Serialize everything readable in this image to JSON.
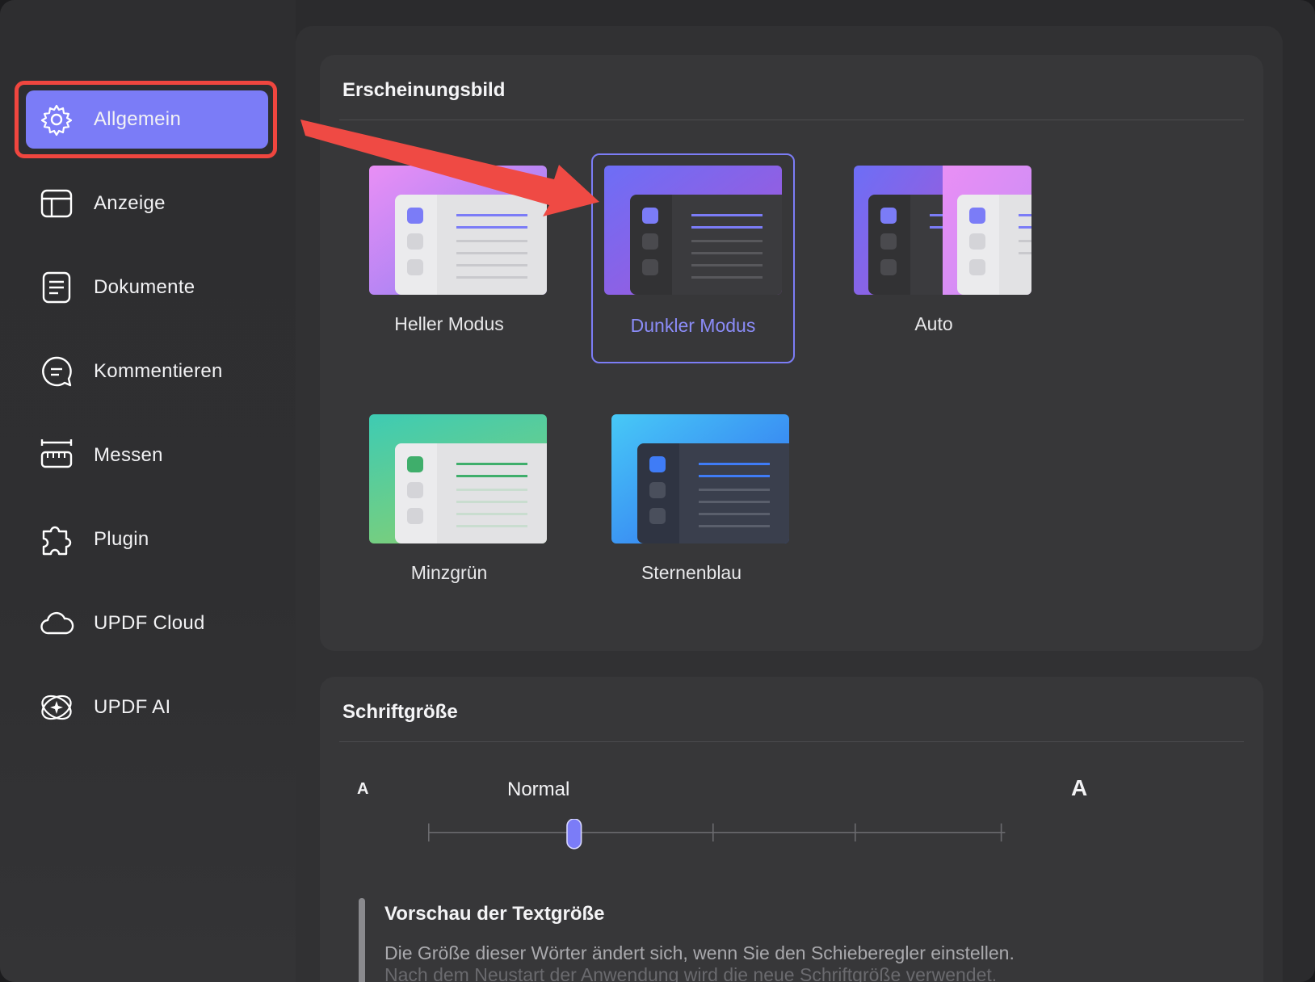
{
  "sidebar": {
    "items": [
      {
        "label": "Allgemein",
        "icon": "gear-icon",
        "active": true
      },
      {
        "label": "Anzeige",
        "icon": "layout-icon"
      },
      {
        "label": "Dokumente",
        "icon": "document-icon"
      },
      {
        "label": "Kommentieren",
        "icon": "comment-icon"
      },
      {
        "label": "Messen",
        "icon": "ruler-icon"
      },
      {
        "label": "Plugin",
        "icon": "puzzle-icon"
      },
      {
        "label": "UPDF Cloud",
        "icon": "cloud-icon"
      },
      {
        "label": "UPDF AI",
        "icon": "ai-sparkle-icon"
      }
    ]
  },
  "appearance": {
    "title": "Erscheinungsbild",
    "themes": [
      {
        "name": "Heller Modus",
        "selected": false
      },
      {
        "name": "Dunkler Modus",
        "selected": true
      },
      {
        "name": "Auto",
        "selected": false
      },
      {
        "name": "Minzgrün",
        "selected": false
      },
      {
        "name": "Sternenblau",
        "selected": false
      }
    ]
  },
  "font_size": {
    "title": "Schriftgröße",
    "small_marker": "A",
    "large_marker": "A",
    "current_label": "Normal",
    "slider_steps": 5,
    "slider_index": 1,
    "preview_title": "Vorschau der Textgröße",
    "preview_line1": "Die Größe dieser Wörter ändert sich, wenn Sie den Schieberegler einstellen.",
    "preview_line2": "Nach dem Neustart der Anwendung wird die neue Schriftgröße verwendet."
  },
  "colors": {
    "accent": "#7b7cf7",
    "annotation_red": "#f0463f"
  }
}
